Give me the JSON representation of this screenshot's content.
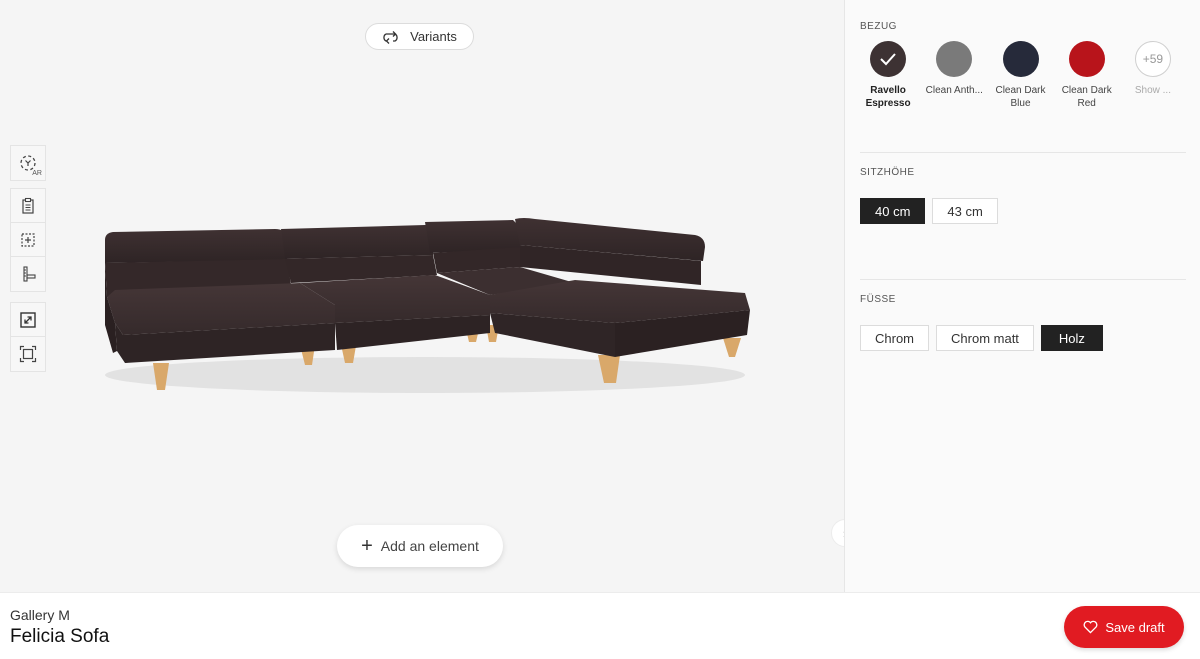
{
  "viewer": {
    "variants_label": "Variants",
    "add_element_label": "Add an element",
    "toolbar": {
      "group1": [
        {
          "icon": "ar-icon",
          "label": "AR"
        }
      ],
      "group2": [
        {
          "icon": "clipboard-icon"
        },
        {
          "icon": "add-frame-icon"
        },
        {
          "icon": "measure-icon"
        }
      ],
      "group3": [
        {
          "icon": "expand-icon"
        },
        {
          "icon": "fit-frame-icon"
        }
      ]
    },
    "product_colors": {
      "fabric": "#3a2d2e",
      "legs": "#d9a86a"
    }
  },
  "panel": {
    "bezug": {
      "title": "BEZUG",
      "swatches": [
        {
          "name": "Ravello\nEspresso",
          "color": "#3d3233",
          "selected": true
        },
        {
          "name": "Clean Anth...",
          "color": "#7a7a7a",
          "selected": false
        },
        {
          "name": "Clean Dark\nBlue",
          "color": "#262a3a",
          "selected": false
        },
        {
          "name": "Clean Dark\nRed",
          "color": "#b8141b",
          "selected": false
        }
      ],
      "more": {
        "count": "+59",
        "label": "Show ..."
      }
    },
    "sitzhoehe": {
      "title": "SITZHÖHE",
      "options": [
        {
          "label": "40 cm",
          "active": true
        },
        {
          "label": "43 cm",
          "active": false
        }
      ]
    },
    "fuesse": {
      "title": "FÜSSE",
      "options": [
        {
          "label": "Chrom",
          "active": false
        },
        {
          "label": "Chrom matt",
          "active": false
        },
        {
          "label": "Holz",
          "active": true
        }
      ]
    }
  },
  "footer": {
    "brand": "Gallery M",
    "product": "Felicia Sofa",
    "save_label": "Save draft",
    "accent": "#e11b22"
  }
}
